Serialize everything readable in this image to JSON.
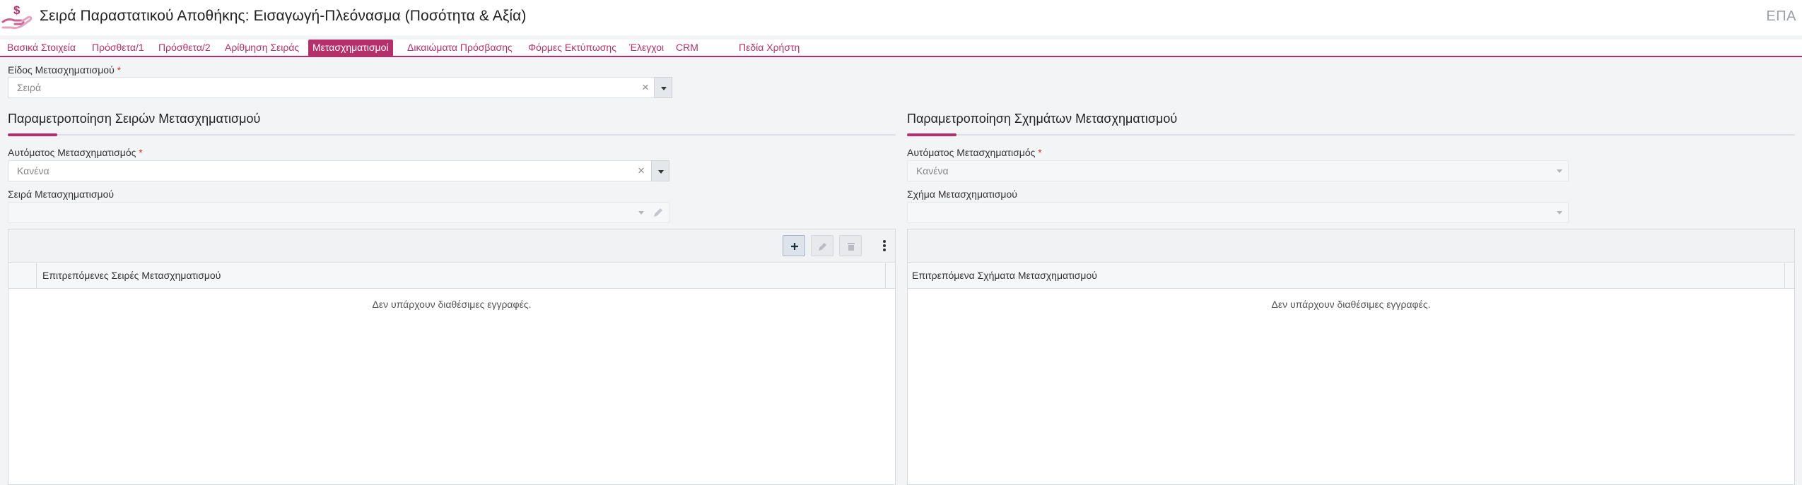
{
  "header": {
    "title": "Σειρά Παραστατικού Αποθήκης: Εισαγωγή-Πλεόνασμα (Ποσότητα & Αξία)",
    "right_text": "ΕΠΑ",
    "icon": "money-hand-icon"
  },
  "tabs": [
    {
      "label": "Βασικά Στοιχεία"
    },
    {
      "label": "Πρόσθετα/1"
    },
    {
      "label": "Πρόσθετα/2"
    },
    {
      "label": "Αρίθμηση Σειράς"
    },
    {
      "label": "Μετασχηματισμοί",
      "active": true
    },
    {
      "label": "Δικαιώματα Πρόσβασης"
    },
    {
      "label": "Φόρμες Εκτύπωσης"
    },
    {
      "label": "Έλεγχοι"
    },
    {
      "label": "CRM"
    },
    {
      "label": "Πεδία Χρήστη"
    }
  ],
  "transform_type": {
    "label": "Είδος Μετασχηματισμού",
    "required_mark": "*",
    "value": "Σειρά"
  },
  "left": {
    "section_title": "Παραμετροποίηση Σειρών Μετασχηματισμού",
    "auto_label": "Αυτόματος Μετασχηματισμός",
    "auto_required": "*",
    "auto_value": "Κανένα",
    "series_label": "Σειρά Μετασχηματισμού",
    "series_value": "",
    "grid": {
      "column": "Επιτρεπόμενες Σειρές Μετασχηματισμού",
      "empty_text": "Δεν υπάρχουν διαθέσιμες εγγραφές."
    }
  },
  "right": {
    "section_title": "Παραμετροποίηση Σχημάτων Μετασχηματισμού",
    "auto_label": "Αυτόματος Μετασχηματισμός",
    "auto_required": "*",
    "auto_value": "Κανένα",
    "schema_label": "Σχήμα Μετασχηματισμού",
    "schema_value": "",
    "grid": {
      "column": "Επιτρεπόμενα Σχήματα Μετασχηματισμού",
      "empty_text": "Δεν υπάρχουν διαθέσιμες εγγραφές."
    }
  },
  "colors": {
    "accent": "#b5306a",
    "background": "#f3f4f6"
  }
}
